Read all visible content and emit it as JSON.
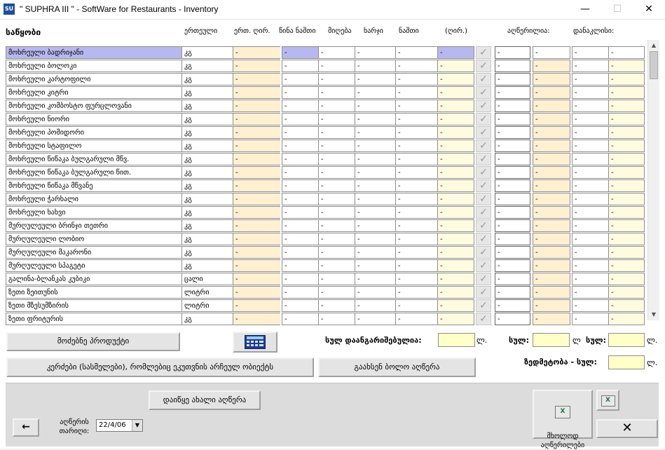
{
  "window": {
    "title": "\" SUPHRA III \" - SoftWare for Restaurants - Inventory",
    "icon": "app-logo-icon"
  },
  "headers": {
    "products": "საწყობი",
    "unit": "ერთეული",
    "unit_price": "ერთ. ღირ.",
    "prev_balance": "წინა ნაშთი",
    "received": "მიღება",
    "expense": "ხარჯი",
    "balance": "ნაშთი",
    "value": "(ღირ.)",
    "counted": "აღწერილია:",
    "difference": "დანაკლისი:"
  },
  "rows": [
    {
      "name": "მოხრეული ბადრიჯანი",
      "unit": "კგ",
      "selected": true
    },
    {
      "name": "მოხრეული ბოლოკი",
      "unit": "კგ"
    },
    {
      "name": "მოხრეული კარტოფილი",
      "unit": "კგ"
    },
    {
      "name": "მოხრეული კიტრი",
      "unit": "კგ"
    },
    {
      "name": "მოხრეული კომბოსტო ფურცლოვანი",
      "unit": "კგ"
    },
    {
      "name": "მოხრეული ნიორი",
      "unit": "კგ"
    },
    {
      "name": "მოხრეული პომიდორი",
      "unit": "კგ"
    },
    {
      "name": "მოხრეული სტაფილო",
      "unit": "კგ"
    },
    {
      "name": "მოხრეული წიწაკა ბულგარული მწვ.",
      "unit": "კგ"
    },
    {
      "name": "მოხრეული წიწაკა ბულგარული წით.",
      "unit": "კგ"
    },
    {
      "name": "მოხრეული წიწაკა მწვანე",
      "unit": "კგ"
    },
    {
      "name": "მოხრეული ჭარხალი",
      "unit": "კგ"
    },
    {
      "name": "მოხრეული ხახვი",
      "unit": "კგ"
    },
    {
      "name": "მურღულეული ბრინჯი თეთრი",
      "unit": "კგ"
    },
    {
      "name": "მურღულეული ლობიო",
      "unit": "კგ"
    },
    {
      "name": "მურღულეული მაკარონი",
      "unit": "კგ"
    },
    {
      "name": "მურღულეული სპაგეტი",
      "unit": "კგ"
    },
    {
      "name": "გალინა-ბლანკას კუბიკი",
      "unit": "ცალი"
    },
    {
      "name": "ზეთი ზეითუნის",
      "unit": "ლიტრი"
    },
    {
      "name": "ზეთი მზესუმზირის",
      "unit": "ლიტრი"
    },
    {
      "name": "ზეთი ფრიტურის",
      "unit": "კგ"
    }
  ],
  "cell_placeholder": "-",
  "check_glyph": "✓",
  "buttons": {
    "search_product": "მოძებნე პროდუქტი",
    "calculator_icon": "calculator-icon",
    "show_items": "კერძები (სასმელები), რომლებიც ეკუთვნის არჩეულ ობიექტს",
    "print_last": "გაახსენ ბოლო აღწერა",
    "start_new": "დაიწყე ახალი აღწერა",
    "only_counted": "მხოლოდ\nაღწერილები",
    "back_icon": "arrow-left-icon",
    "close_icon": "close-icon",
    "excel_icon": "excel-icon"
  },
  "totals": {
    "total_calculated_label": "სულ დაანგარიშებულია:",
    "currency": "ლ.",
    "total_label": "სულ:",
    "currency_short": "ლ",
    "surplus_label": "ზედმეტობა - სულ:"
  },
  "date": {
    "label": "აღწერის თარიღი:",
    "value": "22/4/06"
  },
  "colors": {
    "selected_row": "#b8b8f0",
    "price_col": "#fff0d2",
    "value_col": "#fffbe0",
    "total_box": "#ffffc8"
  }
}
